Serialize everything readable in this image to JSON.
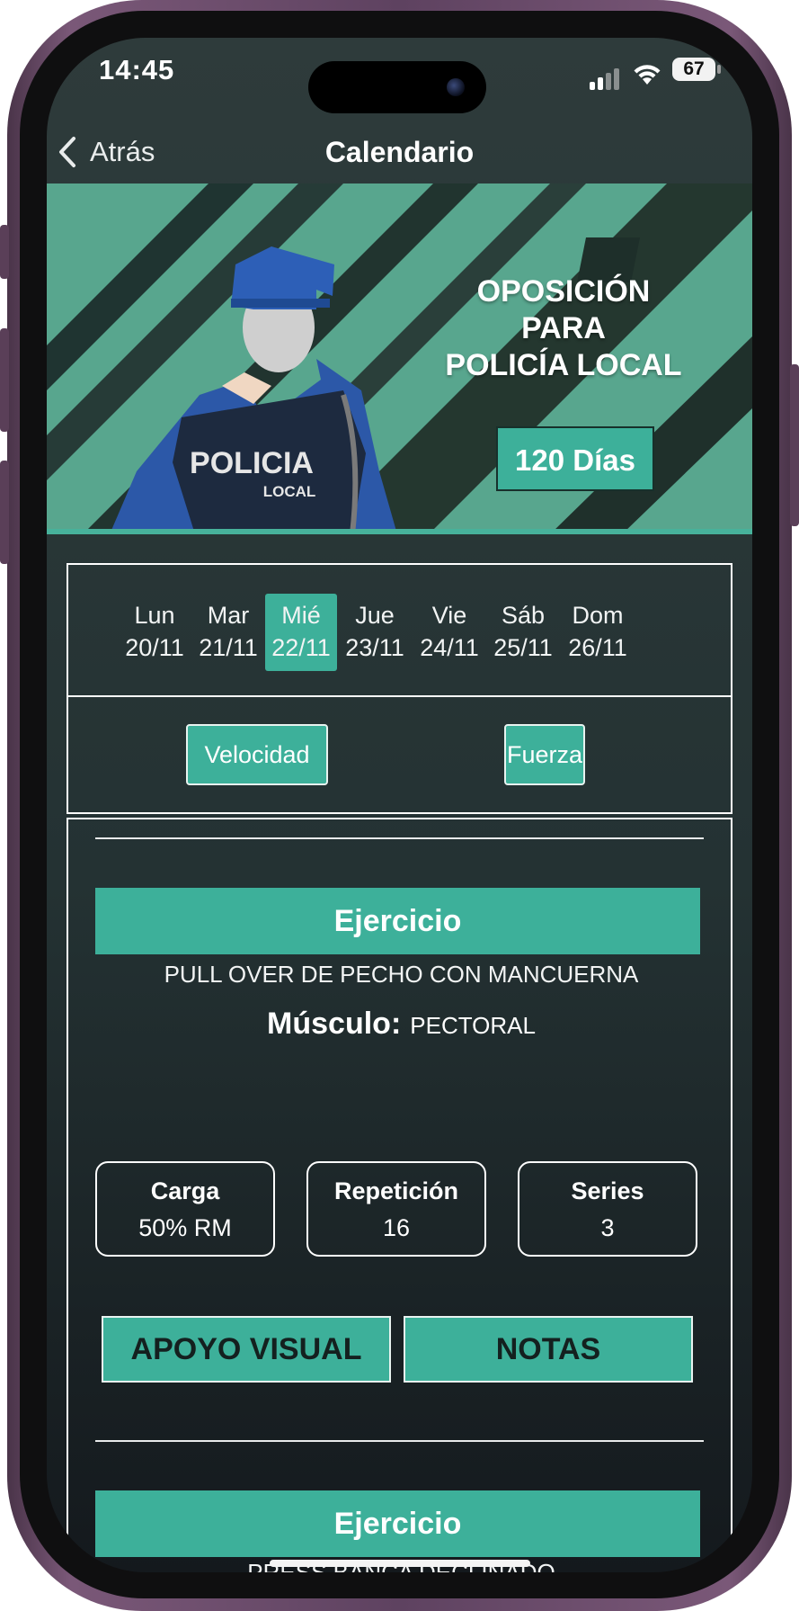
{
  "status_bar": {
    "time": "14:45",
    "battery": "67"
  },
  "nav": {
    "back_label": "Atrás",
    "title": "Calendario"
  },
  "hero": {
    "title_line1": "OPOSICIÓN PARA",
    "title_line2": "POLICÍA LOCAL",
    "vest_text": "POLICIA",
    "vest_subtext": "LOCAL",
    "days_badge": "120 Días"
  },
  "week": [
    {
      "day": "Lun",
      "date": "20/11",
      "selected": false
    },
    {
      "day": "Mar",
      "date": "21/11",
      "selected": false
    },
    {
      "day": "Mié",
      "date": "22/11",
      "selected": true
    },
    {
      "day": "Jue",
      "date": "23/11",
      "selected": false
    },
    {
      "day": "Vie",
      "date": "24/11",
      "selected": false
    },
    {
      "day": "Sáb",
      "date": "25/11",
      "selected": false
    },
    {
      "day": "Dom",
      "date": "26/11",
      "selected": false
    }
  ],
  "categories": [
    "Velocidad",
    "Fuerza"
  ],
  "exercises": [
    {
      "header": "Ejercicio",
      "name": "PULL OVER DE PECHO CON MANCUERNA",
      "muscle_label": "Músculo:",
      "muscle": "PECTORAL",
      "stats": [
        {
          "label": "Carga",
          "value": "50% RM"
        },
        {
          "label": "Repetición",
          "value": "16"
        },
        {
          "label": "Series",
          "value": "3"
        }
      ],
      "actions": [
        "APOYO VISUAL",
        "NOTAS"
      ]
    },
    {
      "header": "Ejercicio",
      "name": "PRESS BANCA DECLINADO"
    }
  ],
  "colors": {
    "accent": "#3db09a",
    "hero_bg": "#58a68e",
    "screen_bg": "#2e3b3b",
    "frame": "#6b4c69"
  }
}
